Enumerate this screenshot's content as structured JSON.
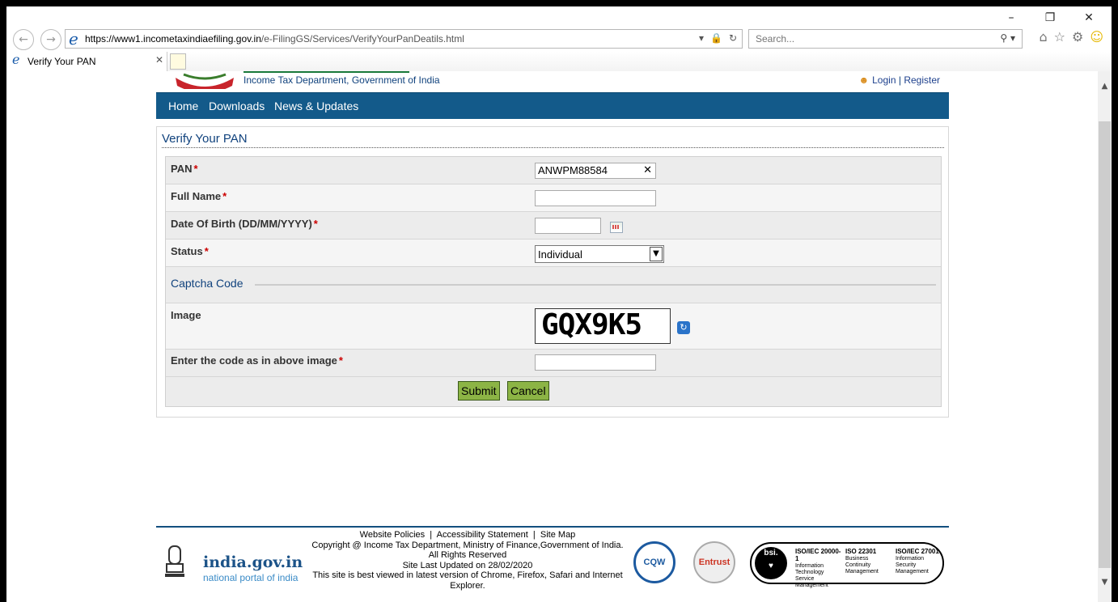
{
  "browser": {
    "url_prefix": "https://www1.",
    "url_domain": "incometaxindiaefiling.gov.in",
    "url_path": "/e-FilingGS/Services/VerifyYourPanDeatils.html",
    "search_placeholder": "Search...",
    "tab_title": "Verify Your PAN",
    "icons": [
      "back-arrow-icon",
      "forward-arrow-icon",
      "ie-logo-icon",
      "lock-icon",
      "refresh-icon",
      "search-icon",
      "home-icon",
      "star-icon",
      "gear-icon",
      "smiley-icon"
    ]
  },
  "header": {
    "dept": "Income Tax Department, Government of India",
    "login": "Login",
    "sep": "|",
    "register": "Register"
  },
  "menu": {
    "home": "Home",
    "downloads": "Downloads",
    "news": "News & Updates"
  },
  "form": {
    "title": "Verify Your PAN",
    "pan_label": "PAN",
    "pan_value": "ANWPM88584",
    "fullname_label": "Full Name",
    "dob_label": "Date Of Birth (DD/MM/YYYY)",
    "status_label": "Status",
    "status_value": "Individual",
    "captcha_heading": "Captcha Code",
    "image_label": "Image",
    "captcha_text": "GQX9K5",
    "code_label": "Enter the code as in above image",
    "required": "*",
    "submit": "Submit",
    "cancel": "Cancel"
  },
  "footer": {
    "link_policies": "Website Policies",
    "link_access": "Accessibility Statement",
    "link_sitemap": "Site Map",
    "sep": "|",
    "copyright": "Copyright @ Income Tax Department, Ministry of Finance,Government of India.",
    "rights": "All Rights Reserved",
    "updated": "Site Last Updated on 28/02/2020",
    "best_viewed": "This site is best viewed in latest version of Chrome, Firefox, Safari and Internet Explorer.",
    "igov": "india.gov.in",
    "igov_sub": "national portal of india",
    "cqw": "CQW",
    "entrust": "Entrust",
    "bsi": "bsi.",
    "iso1_title": "ISO/IEC 20000-1",
    "iso1_sub": "Information Technology Service Management",
    "iso2_title": "ISO 22301",
    "iso2_sub": "Business Continuity Management",
    "iso3_title": "ISO/IEC 27001",
    "iso3_sub": "Information Security Management"
  }
}
